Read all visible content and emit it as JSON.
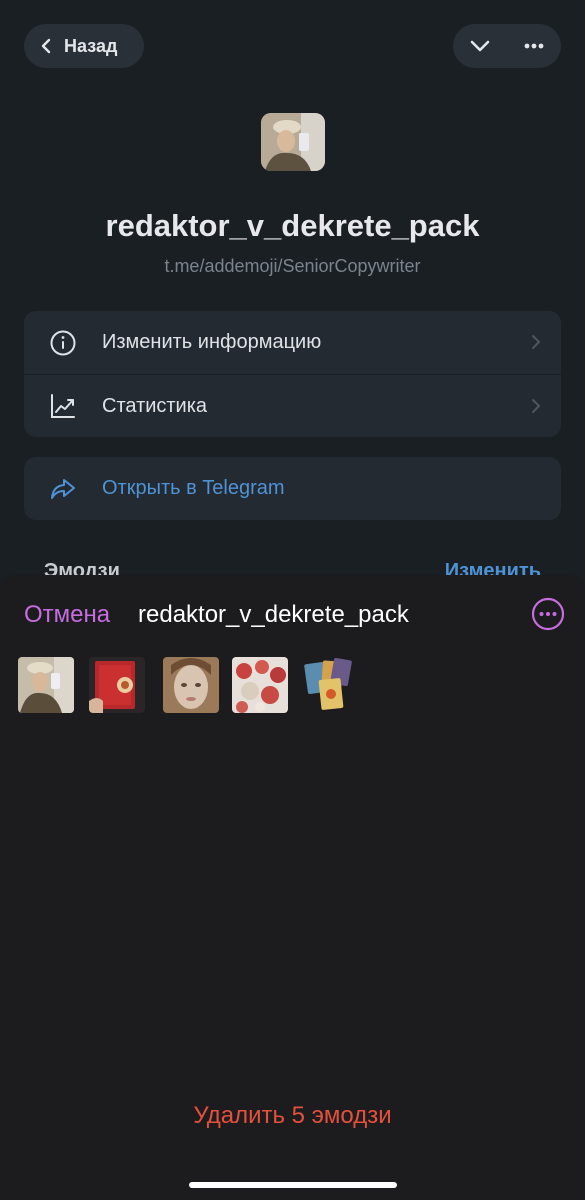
{
  "nav": {
    "back_label": "Назад",
    "chevron_icon": "chevron-down-icon",
    "more_icon": "more-horizontal-icon"
  },
  "pack": {
    "name": "redaktor_v_dekrete_pack",
    "link": "t.me/addemoji/SeniorCopywriter"
  },
  "menu": {
    "items": [
      {
        "label": "Изменить информацию",
        "icon": "info-circle-icon"
      },
      {
        "label": "Статистика",
        "icon": "chart-line-icon"
      }
    ],
    "open_telegram": {
      "label": "Открыть в Telegram",
      "icon": "share-arrow-icon"
    }
  },
  "section": {
    "title": "Эмодзи",
    "edit": "Изменить"
  },
  "sheet": {
    "cancel": "Отмена",
    "title": "redaktor_v_dekrete_pack",
    "more_icon": "more-circle-icon",
    "emojis": [
      {
        "name": "woman-selfie-thumbnail"
      },
      {
        "name": "red-book-thumbnail"
      },
      {
        "name": "face-mask-thumbnail"
      },
      {
        "name": "cookies-thumbnail"
      },
      {
        "name": "tarot-cards-thumbnail"
      }
    ],
    "delete_label": "Удалить 5 эмодзи"
  },
  "colors": {
    "accent_purple": "#c66de0",
    "link_blue": "#4e93d6",
    "danger_red": "#e5503d",
    "background": "#1a1f24",
    "sheet_background": "#1c1c1e"
  }
}
